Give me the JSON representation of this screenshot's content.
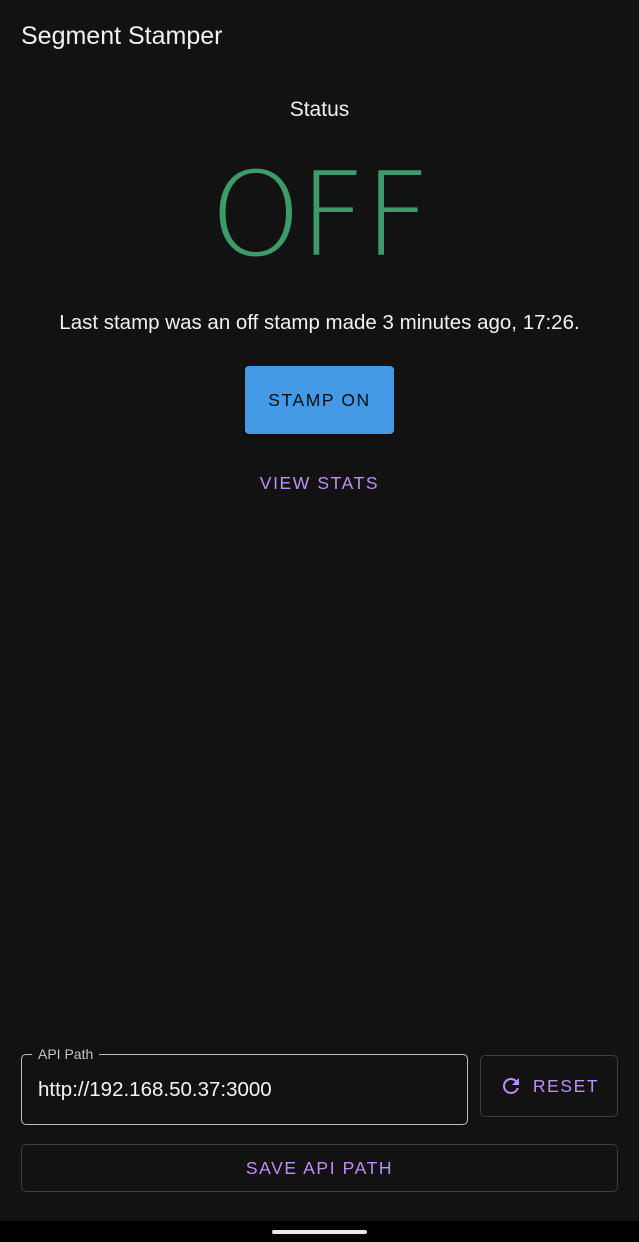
{
  "app": {
    "title": "Segment Stamper"
  },
  "status": {
    "label": "Status",
    "value": "OFF",
    "last_stamp": "Last stamp was an off stamp made 3 minutes ago, 17:26."
  },
  "actions": {
    "stamp_label": "STAMP ON",
    "view_stats_label": "VIEW STATS"
  },
  "api": {
    "field_label": "API Path",
    "value": "http://192.168.50.37:3000",
    "reset_label": "RESET",
    "reset_icon": "refresh-icon",
    "save_label": "SAVE API PATH"
  },
  "colors": {
    "background": "#121212",
    "status_off": "#3d9b67",
    "primary_button": "#4399e3",
    "accent": "#c08ef7"
  }
}
